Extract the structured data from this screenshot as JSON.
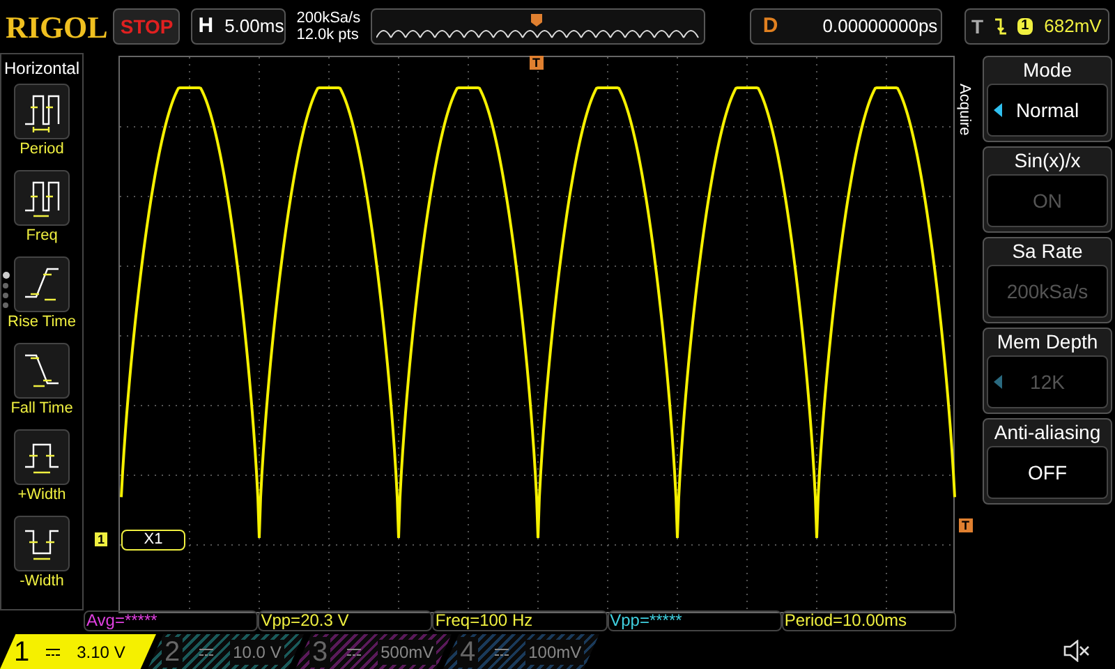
{
  "top_bar": {
    "logo": "RIGOL",
    "run_status": "STOP",
    "horizontal": {
      "label": "H",
      "timebase": "5.00ms"
    },
    "sample_rate": "200kSa/s",
    "memory": "12.0k pts",
    "delay": {
      "label": "D",
      "value": "0.00000000ps"
    },
    "trigger": {
      "label": "T",
      "channel": "1",
      "level": "682mV"
    }
  },
  "left_menu": {
    "title": "Horizontal",
    "items": [
      {
        "label": "Period",
        "kind": "period"
      },
      {
        "label": "Freq",
        "kind": "freq"
      },
      {
        "label": "Rise Time",
        "kind": "rise"
      },
      {
        "label": "Fall Time",
        "kind": "fall"
      },
      {
        "label": "+Width",
        "kind": "pwidth"
      },
      {
        "label": "-Width",
        "kind": "nwidth"
      }
    ],
    "pages": [
      {
        "selected": true
      },
      {
        "selected": false
      },
      {
        "selected": false
      },
      {
        "selected": false
      }
    ]
  },
  "screen": {
    "trigger_position_marker": "T",
    "trigger_level_marker": "T",
    "channel_marker": "1",
    "cursor_label": "X1"
  },
  "right_menu": {
    "title": "Acquire",
    "items": [
      {
        "label": "Mode",
        "value": "Normal",
        "disabled": false,
        "arrow": true
      },
      {
        "label": "Sin(x)/x",
        "value": "ON",
        "disabled": true,
        "arrow": false
      },
      {
        "label": "Sa Rate",
        "value": "200kSa/s",
        "disabled": true,
        "arrow": false
      },
      {
        "label": "Mem Depth",
        "value": "12K",
        "disabled": true,
        "arrow": true
      },
      {
        "label": "Anti-aliasing",
        "value": "OFF",
        "disabled": false,
        "arrow": false
      }
    ]
  },
  "measurements": [
    {
      "text": "Avg=*****",
      "color": "#e040e0"
    },
    {
      "text": "Vpp=20.3 V",
      "color": "#f0f040"
    },
    {
      "text": "Freq=100 Hz",
      "color": "#f0f040"
    },
    {
      "text": "Vpp=*****",
      "color": "#40d0e0"
    },
    {
      "text": "Period=10.00ms",
      "color": "#f0f040"
    }
  ],
  "channels": [
    {
      "number": "1",
      "scale": "3.10 V",
      "on": true,
      "color": "#f5f000"
    },
    {
      "number": "2",
      "scale": "10.0 V",
      "on": false,
      "color": "#1a5a5a"
    },
    {
      "number": "3",
      "scale": "500mV",
      "on": false,
      "color": "#5a1a5a"
    },
    {
      "number": "4",
      "scale": "100mV",
      "on": false,
      "color": "#1a3a5a"
    }
  ]
}
